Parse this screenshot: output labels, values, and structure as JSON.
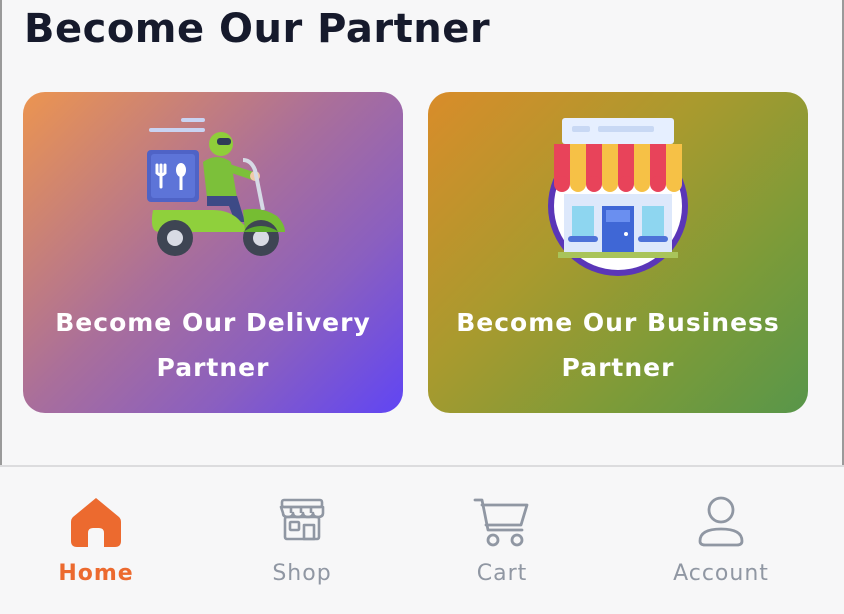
{
  "page": {
    "title": "Become Our Partner"
  },
  "cards": [
    {
      "label": "Become Our Delivery Partner",
      "icon": "delivery-scooter-icon"
    },
    {
      "label": "Become Our Business Partner",
      "icon": "storefront-icon"
    }
  ],
  "nav": {
    "items": [
      {
        "label": "Home",
        "icon": "home-icon",
        "active": true
      },
      {
        "label": "Shop",
        "icon": "shop-icon",
        "active": false
      },
      {
        "label": "Cart",
        "icon": "cart-icon",
        "active": false
      },
      {
        "label": "Account",
        "icon": "account-icon",
        "active": false
      }
    ]
  },
  "colors": {
    "active": "#ec6a2f",
    "inactive": "#9097a3",
    "title": "#161a2c"
  }
}
